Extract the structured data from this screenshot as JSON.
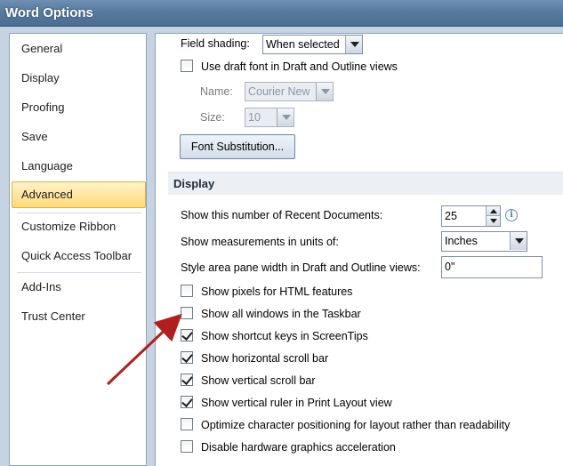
{
  "window": {
    "title": "Word Options"
  },
  "sidebar": {
    "items": [
      {
        "label": "General"
      },
      {
        "label": "Display"
      },
      {
        "label": "Proofing"
      },
      {
        "label": "Save"
      },
      {
        "label": "Language"
      },
      {
        "label": "Advanced",
        "selected": true
      },
      {
        "label": "Customize Ribbon"
      },
      {
        "label": "Quick Access Toolbar"
      },
      {
        "label": "Add-Ins"
      },
      {
        "label": "Trust Center"
      }
    ]
  },
  "main": {
    "field_shading": {
      "label": "Field shading:",
      "value": "When selected"
    },
    "draft_font": {
      "label": "Use draft font in Draft and Outline views",
      "checked": false
    },
    "font_name": {
      "label": "Name:",
      "value": "Courier New"
    },
    "font_size": {
      "label": "Size:",
      "value": "10"
    },
    "font_substitution_button": "Font Substitution...",
    "display_section": {
      "title": "Display",
      "recent_docs": {
        "label": "Show this number of Recent Documents:",
        "value": "25"
      },
      "measurements": {
        "label": "Show measurements in units of:",
        "value": "Inches"
      },
      "style_area": {
        "label": "Style area pane width in Draft and Outline views:",
        "value": "0\""
      },
      "options": [
        {
          "label": "Show pixels for HTML features",
          "checked": false
        },
        {
          "label": "Show all windows in the Taskbar",
          "checked": false
        },
        {
          "label": "Show shortcut keys in ScreenTips",
          "checked": true
        },
        {
          "label": "Show horizontal scroll bar",
          "checked": true
        },
        {
          "label": "Show vertical scroll bar",
          "checked": true
        },
        {
          "label": "Show vertical ruler in Print Layout view",
          "checked": true
        },
        {
          "label": "Optimize character positioning for layout rather than readability",
          "checked": false
        },
        {
          "label": "Disable hardware graphics acceleration",
          "checked": false
        }
      ]
    }
  },
  "icons": {
    "info": "info-icon",
    "annotation_arrow": "red-arrow-annotation"
  },
  "colors": {
    "selected_item": "#ffd978",
    "title_bar": "#587a9f",
    "annotation_arrow": "#b01e1e"
  }
}
